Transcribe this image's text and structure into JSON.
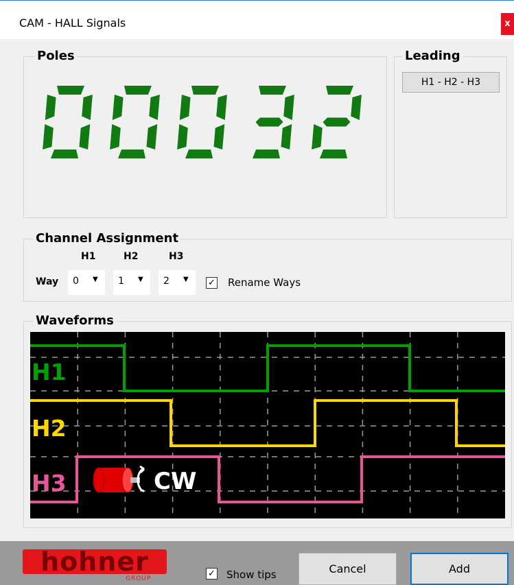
{
  "window": {
    "title": "CAM - HALL Signals",
    "close_label": "x"
  },
  "poles": {
    "label": "Poles",
    "value": "00032"
  },
  "leading": {
    "label": "Leading",
    "button_label": "H1 - H2 - H3"
  },
  "channel_assignment": {
    "label": "Channel Assignment",
    "row_label": "Way",
    "channels": [
      {
        "name": "H1",
        "value": "0"
      },
      {
        "name": "H2",
        "value": "1"
      },
      {
        "name": "H3",
        "value": "2"
      }
    ],
    "rename_ways": {
      "label": "Rename Ways",
      "checked": true
    }
  },
  "waveforms": {
    "label": "Waveforms",
    "direction": "CW",
    "signals": [
      {
        "name": "H1",
        "color": "#00a000"
      },
      {
        "name": "H2",
        "color": "#ffd700"
      },
      {
        "name": "H3",
        "color": "#e8559a"
      }
    ]
  },
  "footer": {
    "logo_text": "hohner",
    "logo_sub": "GROUP",
    "show_tips": {
      "label": "Show tips",
      "checked": true
    },
    "cancel_label": "Cancel",
    "add_label": "Add"
  },
  "colors": {
    "segment_green": "#127a12",
    "accent_blue": "#0078d7",
    "close_red": "#e81123",
    "logo_red": "#e3161c"
  }
}
